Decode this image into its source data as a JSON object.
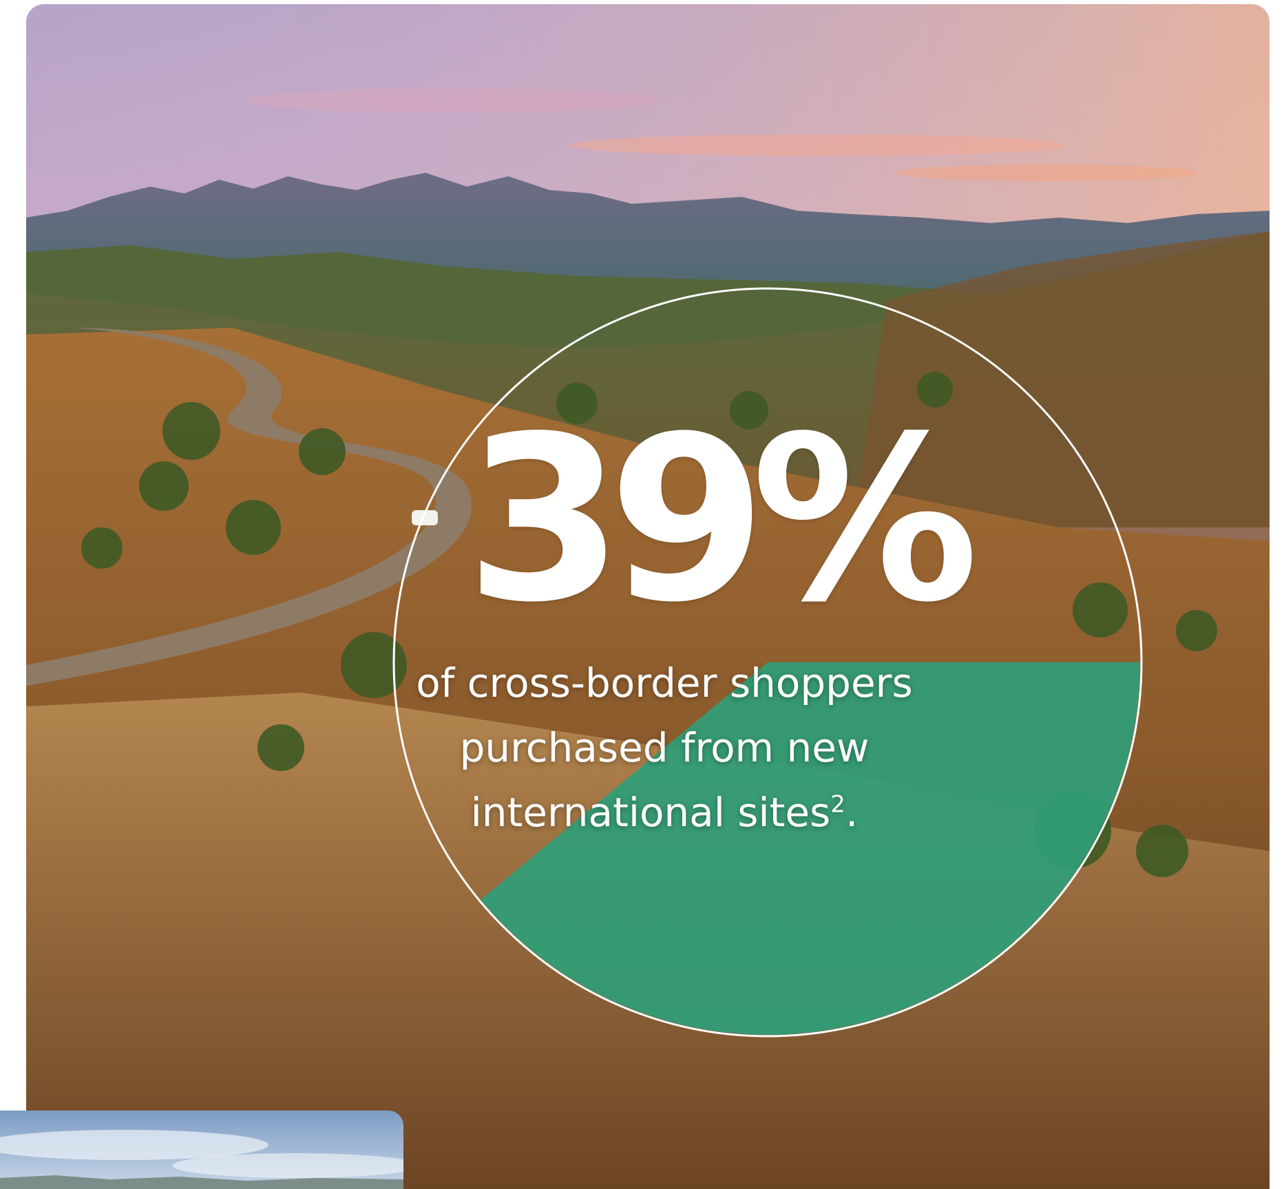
{
  "stat": {
    "value": "39%",
    "value_fraction": 0.39,
    "caption_lines": [
      "of cross-border shoppers",
      "purchased from new",
      "international sites"
    ],
    "footnote": "2",
    "period": "."
  },
  "colors": {
    "accent": "#2f9e78",
    "ring": "#ffffff",
    "text": "#ffffff"
  },
  "icons": {
    "hero": "landscape-photo",
    "inset": "sky-photo"
  }
}
